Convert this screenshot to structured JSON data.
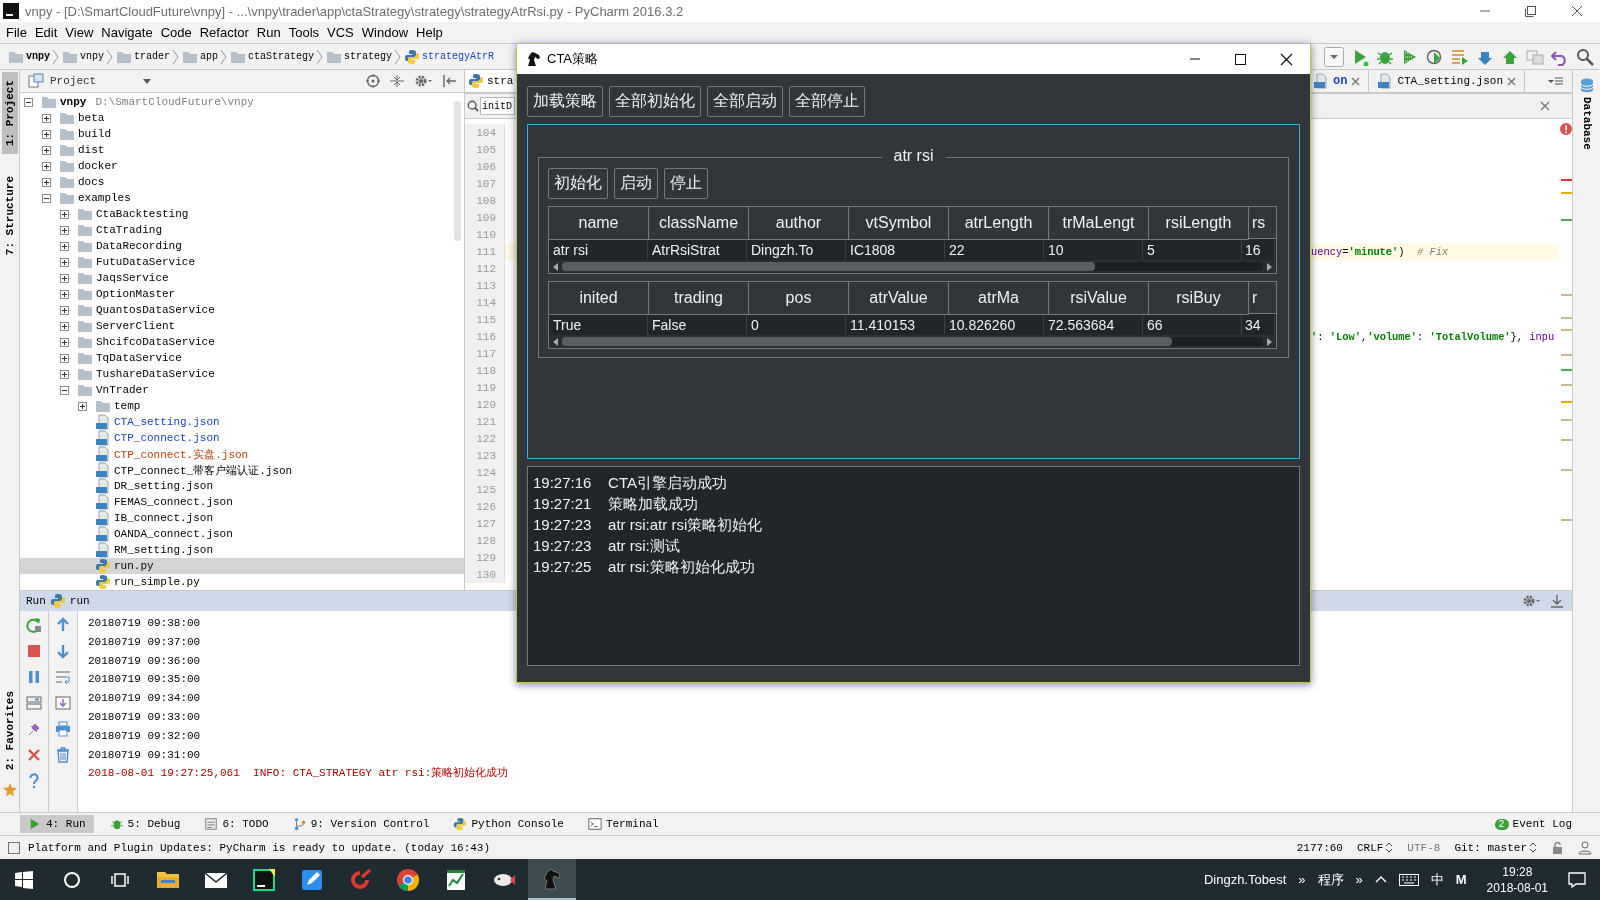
{
  "window": {
    "title": "vnpy - [D:\\SmartCloudFuture\\vnpy] - ...\\vnpy\\trader\\app\\ctaStrategy\\strategy\\strategyAtrRsi.py - PyCharm 2016.3.2"
  },
  "menu": [
    "File",
    "Edit",
    "View",
    "Navigate",
    "Code",
    "Refactor",
    "Run",
    "Tools",
    "VCS",
    "Window",
    "Help"
  ],
  "breadcrumbs": [
    {
      "label": "vnpy",
      "kind": "folder",
      "bold": true
    },
    {
      "label": "vnpy",
      "kind": "folder",
      "bold": false
    },
    {
      "label": "trader",
      "kind": "folder",
      "bold": false
    },
    {
      "label": "app",
      "kind": "folder",
      "bold": false
    },
    {
      "label": "ctaStrategy",
      "kind": "folder",
      "bold": false
    },
    {
      "label": "strategy",
      "kind": "folder",
      "bold": false
    },
    {
      "label": "strategyAtrR",
      "kind": "python",
      "bold": false
    }
  ],
  "left_strip": {
    "top": [
      {
        "label": "1: Project",
        "selected": true
      },
      {
        "label": "7: Structure",
        "selected": false
      }
    ],
    "bottom": [
      {
        "label": "2: Favorites",
        "selected": false
      }
    ]
  },
  "project_panel": {
    "title": "Project",
    "tree": [
      {
        "label": "vnpy",
        "path": "D:\\SmartCloudFuture\\vnpy",
        "kind": "folder",
        "expanded": true,
        "selected": false,
        "children": [
          {
            "label": "beta",
            "kind": "folder",
            "expanded": false,
            "selected": false
          },
          {
            "label": "build",
            "kind": "folder",
            "expanded": false,
            "selected": false
          },
          {
            "label": "dist",
            "kind": "folder",
            "expanded": false,
            "selected": false
          },
          {
            "label": "docker",
            "kind": "folder",
            "expanded": false,
            "selected": false
          },
          {
            "label": "docs",
            "kind": "folder",
            "expanded": false,
            "selected": false
          },
          {
            "label": "examples",
            "kind": "folder",
            "expanded": true,
            "selected": false,
            "children": [
              {
                "label": "CtaBacktesting",
                "kind": "folder",
                "expanded": false,
                "selected": false
              },
              {
                "label": "CtaTrading",
                "kind": "folder",
                "expanded": false,
                "selected": false
              },
              {
                "label": "DataRecording",
                "kind": "folder",
                "expanded": false,
                "selected": false
              },
              {
                "label": "FutuDataService",
                "kind": "folder",
                "expanded": false,
                "selected": false
              },
              {
                "label": "JaqsService",
                "kind": "folder",
                "expanded": false,
                "selected": false
              },
              {
                "label": "OptionMaster",
                "kind": "folder",
                "expanded": false,
                "selected": false
              },
              {
                "label": "QuantosDataService",
                "kind": "folder",
                "expanded": false,
                "selected": false
              },
              {
                "label": "ServerClient",
                "kind": "folder",
                "expanded": false,
                "selected": false
              },
              {
                "label": "ShcifcoDataService",
                "kind": "folder",
                "expanded": false,
                "selected": false
              },
              {
                "label": "TqDataService",
                "kind": "folder",
                "expanded": false,
                "selected": false
              },
              {
                "label": "TushareDataService",
                "kind": "folder",
                "expanded": false,
                "selected": false
              },
              {
                "label": "VnTrader",
                "kind": "folder",
                "expanded": true,
                "selected": false,
                "children": [
                  {
                    "label": "temp",
                    "kind": "folder",
                    "expanded": false,
                    "selected": false
                  },
                  {
                    "label": "CTA_setting.json",
                    "kind": "json",
                    "selected": false,
                    "color": "#1d44b8"
                  },
                  {
                    "label": "CTP_connect.json",
                    "kind": "json",
                    "selected": false,
                    "color": "#1d44b8"
                  },
                  {
                    "label": "CTP_connect.实盘.json",
                    "kind": "json",
                    "selected": false,
                    "color": "#b0420c"
                  },
                  {
                    "label": "CTP_connect_带客户端认证.json",
                    "kind": "json",
                    "selected": false
                  },
                  {
                    "label": "DR_setting.json",
                    "kind": "json",
                    "selected": false
                  },
                  {
                    "label": "FEMAS_connect.json",
                    "kind": "json",
                    "selected": false
                  },
                  {
                    "label": "IB_connect.json",
                    "kind": "json",
                    "selected": false
                  },
                  {
                    "label": "OANDA_connect.json",
                    "kind": "json",
                    "selected": false
                  },
                  {
                    "label": "RM_setting.json",
                    "kind": "json",
                    "selected": false
                  },
                  {
                    "label": "run.py",
                    "kind": "python",
                    "selected": true
                  },
                  {
                    "label": "run_simple.py",
                    "kind": "python",
                    "selected": false
                  }
                ]
              }
            ]
          }
        ]
      }
    ]
  },
  "editor": {
    "tabs": [
      {
        "label": "stra",
        "kind": "python",
        "selected": true,
        "closable": false
      },
      {
        "label": "on",
        "kind": "json",
        "selected": false,
        "closable": true,
        "color": "#1d44b8"
      },
      {
        "label": "CTA_setting.json",
        "kind": "json",
        "selected": false,
        "closable": true
      }
    ],
    "find_field": {
      "value": "initD"
    },
    "lines": [
      {
        "number": "104",
        "highlighted": false
      },
      {
        "number": "105",
        "highlighted": false
      },
      {
        "number": "106",
        "highlighted": false
      },
      {
        "number": "107",
        "highlighted": false
      },
      {
        "number": "108",
        "highlighted": false
      },
      {
        "number": "109",
        "highlighted": false
      },
      {
        "number": "110",
        "highlighted": false
      },
      {
        "number": "111",
        "highlighted": true,
        "code": [
          {
            "kind": "param",
            "text": "uency"
          },
          {
            "kind": "plain",
            "text": "="
          },
          {
            "kind": "string",
            "text": "'minute'"
          },
          {
            "kind": "plain",
            "text": ")  "
          },
          {
            "kind": "comment",
            "text": "# Fix"
          }
        ]
      },
      {
        "number": "112",
        "highlighted": false
      },
      {
        "number": "113",
        "highlighted": false
      },
      {
        "number": "114",
        "highlighted": false
      },
      {
        "number": "115",
        "highlighted": false
      },
      {
        "number": "116",
        "highlighted": false,
        "code": [
          {
            "kind": "string",
            "text": "'"
          },
          {
            "kind": "plain",
            "text": ": "
          },
          {
            "kind": "string",
            "text": "'Low'"
          },
          {
            "kind": "plain",
            "text": ","
          },
          {
            "kind": "string",
            "text": "'volume'"
          },
          {
            "kind": "plain",
            "text": ": "
          },
          {
            "kind": "string",
            "text": "'TotalVolume'"
          },
          {
            "kind": "plain",
            "text": "}, "
          },
          {
            "kind": "param",
            "text": "inpu"
          }
        ]
      },
      {
        "number": "117",
        "highlighted": false
      },
      {
        "number": "118",
        "highlighted": false
      },
      {
        "number": "119",
        "highlighted": false
      },
      {
        "number": "120",
        "highlighted": false
      },
      {
        "number": "121",
        "highlighted": false
      },
      {
        "number": "122",
        "highlighted": false
      },
      {
        "number": "123",
        "highlighted": false
      },
      {
        "number": "124",
        "highlighted": false
      },
      {
        "number": "125",
        "highlighted": false
      },
      {
        "number": "126",
        "highlighted": false
      },
      {
        "number": "127",
        "highlighted": false
      },
      {
        "number": "128",
        "highlighted": false
      },
      {
        "number": "129",
        "highlighted": false
      },
      {
        "number": "130",
        "highlighted": false
      }
    ]
  },
  "right_strip": {
    "label": "Database"
  },
  "run_panel": {
    "title": "Run",
    "config": "run",
    "output": [
      {
        "kind": "stdout",
        "text": "20180719 09:38:00"
      },
      {
        "kind": "stdout",
        "text": "20180719 09:37:00"
      },
      {
        "kind": "stdout",
        "text": "20180719 09:36:00"
      },
      {
        "kind": "stdout",
        "text": "20180719 09:35:00"
      },
      {
        "kind": "stdout",
        "text": "20180719 09:34:00"
      },
      {
        "kind": "stdout",
        "text": "20180719 09:33:00"
      },
      {
        "kind": "stdout",
        "text": "20180719 09:32:00"
      },
      {
        "kind": "stdout",
        "text": "20180719 09:31:00"
      },
      {
        "kind": "stderr",
        "text": "2018-08-01 19:27:25,061  INFO: CTA_STRATEGY atr rsi:策略初始化成功"
      }
    ]
  },
  "tool_windows": [
    {
      "label": "4: Run",
      "kind": "run",
      "selected": true
    },
    {
      "label": "5: Debug",
      "kind": "debug",
      "selected": false
    },
    {
      "label": "6: TODO",
      "kind": "todo",
      "selected": false
    },
    {
      "label": "9: Version Control",
      "kind": "vcs",
      "selected": false
    },
    {
      "label": "Python Console",
      "kind": "console",
      "selected": false
    },
    {
      "label": "Terminal",
      "kind": "terminal",
      "selected": false
    }
  ],
  "event_log": {
    "label": "Event Log",
    "badge": "2"
  },
  "status_bar": {
    "message": "Platform and Plugin Updates: PyCharm is ready to update. (today 16:43)",
    "position": "2177:60",
    "line_separator": "CRLF",
    "encoding": "UTF-8",
    "branch": "Git: master"
  },
  "cta_window": {
    "title": "CTA策略",
    "buttons": [
      "加载策略",
      "全部初始化",
      "全部启动",
      "全部停止"
    ],
    "strategy": {
      "name": "atr rsi",
      "buttons": [
        "初始化",
        "启动",
        "停止"
      ],
      "tables": [
        {
          "columns": [
            "name",
            "className",
            "author",
            "vtSymbol",
            "atrLength",
            "trMaLengt",
            "rsiLength",
            "rs"
          ],
          "row": [
            "atr rsi",
            "AtrRsiStrat",
            "Dingzh.To",
            "IC1808",
            "22",
            "10",
            "5",
            "16"
          ]
        },
        {
          "columns": [
            "inited",
            "trading",
            "pos",
            "atrValue",
            "atrMa",
            "rsiValue",
            "rsiBuy",
            "r"
          ],
          "row": [
            "True",
            "False",
            "0",
            "11.410153",
            "10.826260",
            "72.563684",
            "66",
            "34"
          ]
        }
      ]
    },
    "log": [
      "19:27:16    CTA引擎启动成功",
      "19:27:21    策略加载成功",
      "19:27:23    atr rsi:atr rsi策略初始化",
      "19:27:23    atr rsi:测试",
      "19:27:25    atr rsi:策略初始化成功"
    ]
  },
  "taskbar": {
    "apps": [
      {
        "kind": "explorer",
        "active": false
      },
      {
        "kind": "mail",
        "active": false
      },
      {
        "kind": "pycharm",
        "active": false
      },
      {
        "kind": "notes",
        "active": false
      },
      {
        "kind": "swirl",
        "active": false
      },
      {
        "kind": "chrome",
        "active": false
      },
      {
        "kind": "sheet",
        "active": false
      },
      {
        "kind": "fish",
        "active": false
      },
      {
        "kind": "horse",
        "active": true
      }
    ],
    "user": "Dingzh.Tobest",
    "tray": [
      "»",
      "程序",
      "»"
    ],
    "ime": "中",
    "ime_mode": "M",
    "time": "19:28",
    "date": "2018-08-01"
  }
}
